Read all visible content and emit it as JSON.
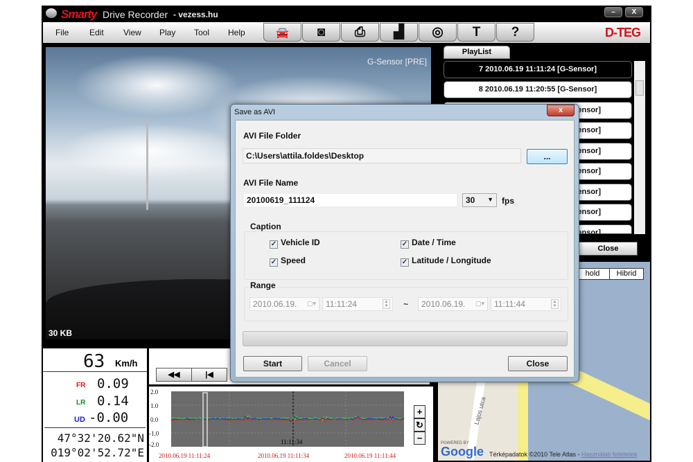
{
  "window": {
    "brand": "Smarty",
    "app_name": "Drive Recorder",
    "site": "- vezess.hu",
    "minimize": "–",
    "close": "X",
    "vendor_logo": "D-TEG"
  },
  "menu": [
    "File",
    "Edit",
    "View",
    "Play",
    "Tool",
    "Help"
  ],
  "toolbar": [
    {
      "icon": "car-folder-icon",
      "glyph": "🚘"
    },
    {
      "icon": "camera-icon",
      "glyph": "◙"
    },
    {
      "icon": "printer-icon",
      "glyph": "⎙"
    },
    {
      "icon": "clapperboard-icon",
      "glyph": "▟"
    },
    {
      "icon": "disc-icon",
      "glyph": "◎"
    },
    {
      "icon": "hammer-icon",
      "glyph": "T"
    },
    {
      "icon": "help-icon",
      "glyph": "?"
    }
  ],
  "video": {
    "overlay_mode": "G-Sensor [PRE]",
    "size": "30 KB"
  },
  "playlist": {
    "tab": "PlayList",
    "items": [
      "7  2010.06.19 11:11:24 [G-Sensor]",
      "8  2010.06.19 11:20:55 [G-Sensor]",
      "ensor]",
      "ensor]",
      "ensor]",
      "ensor]",
      "ensor]",
      "ensor]",
      "ensor]"
    ],
    "selected_index": 0,
    "close": "Close"
  },
  "map": {
    "map_button": "hold",
    "hybrid_button": "Hibrid",
    "street": "Lajos utca",
    "powered_by": "POWERED BY",
    "google": "Google",
    "attribution": "Térképadatok ©2010 Tele Atlas - ",
    "terms_link": "Használati feltételek"
  },
  "info": {
    "speed": "63",
    "speed_unit": "Km/h",
    "fr_label": "FR",
    "fr": "0.09",
    "lr_label": "LR",
    "lr": "0.14",
    "ud_label": "UD",
    "ud": "-0.00",
    "lat": "47°32'20.62\"N",
    "lon": "019°02'52.72\"E",
    "colors": {
      "fr": "#e0141a",
      "lr": "#1a8a1a",
      "ud": "#1a1ad0"
    }
  },
  "controls": {
    "rewind": "◀◀",
    "prev": "|◀"
  },
  "graph": {
    "y_ticks": [
      "2.0",
      "1.0",
      "0.0",
      "-1.0",
      "-2.0"
    ],
    "x_ticks": [
      "2010.06.19 11:11:24",
      "2010.06.19 11:11:34",
      "2010.06.19 11:11:44"
    ],
    "cursor_label": "11:11:34",
    "zoom_in": "+",
    "reset": "↻",
    "zoom_out": "−"
  },
  "dialog": {
    "title": "Save as AVI",
    "close": "x",
    "folder_label": "AVI File Folder",
    "folder_value": "C:\\Users\\attila.foldes\\Desktop",
    "browse": "...",
    "name_label": "AVI File Name",
    "name_value": "20100619_111124",
    "fps_value": "30",
    "fps_label": "fps",
    "caption_label": "Caption",
    "captions": [
      {
        "label": "Vehicle ID",
        "checked": true
      },
      {
        "label": "Date / Time",
        "checked": true
      },
      {
        "label": "Speed",
        "checked": true
      },
      {
        "label": "Latitude / Longitude",
        "checked": true
      }
    ],
    "range_label": "Range",
    "range_start_date": "2010.06.19.",
    "range_start_time": "11:11:24",
    "range_sep": "~",
    "range_end_date": "2010.06.19.",
    "range_end_time": "11:11:44",
    "progress": 0,
    "start": "Start",
    "cancel": "Cancel",
    "close_button": "Close"
  }
}
